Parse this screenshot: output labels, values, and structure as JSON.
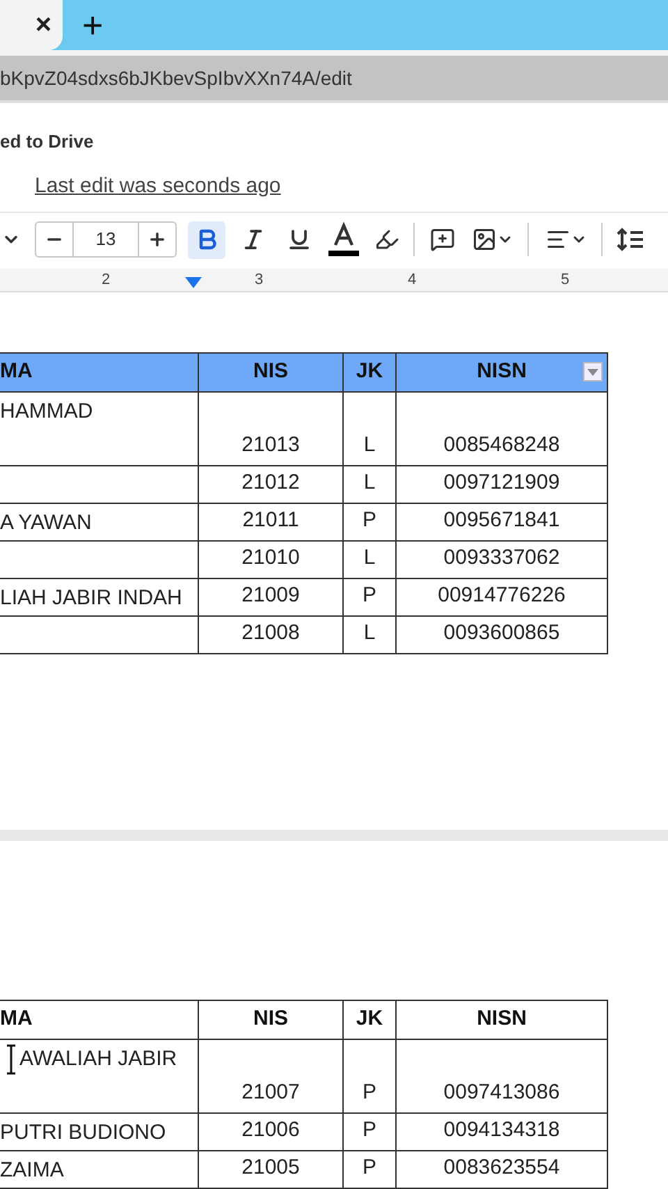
{
  "browser": {
    "close_tab": "×",
    "new_tab": "+",
    "url": "bKpvZ04sdxs6bJKbevSpIbvXXn74A/edit"
  },
  "doc_header": {
    "save_status": "ed to Drive",
    "last_edit": "Last edit was seconds ago"
  },
  "toolbar": {
    "font_size": "13",
    "items": [
      {
        "kind": "bold",
        "selected": true
      },
      {
        "kind": "italic",
        "selected": false
      },
      {
        "kind": "underline",
        "selected": false
      }
    ]
  },
  "ruler": {
    "marks": [
      "2",
      "3",
      "4",
      "5"
    ]
  },
  "tables": [
    {
      "header_highlighted": true,
      "filter": true,
      "columns": [
        "MA",
        "NIS",
        "JK",
        "NISN"
      ],
      "text_cursor": false,
      "rows": [
        {
          "name": "HAMMAD",
          "nis": "21013",
          "jk": "L",
          "nisn": "0085468248",
          "tall": true
        },
        {
          "nis": "21012",
          "jk": "L",
          "nisn": "0097121909",
          "tall": false
        },
        {
          "name": "A YAWAN",
          "nis": "21011",
          "jk": "P",
          "nisn": "0095671841",
          "tall": false
        },
        {
          "nis": "21010",
          "jk": "L",
          "nisn": "0093337062",
          "tall": false
        },
        {
          "name": "LIAH JABIR INDAH",
          "nis": "21009",
          "jk": "P",
          "nisn": "00914776226",
          "tall": false
        },
        {
          "nis": "21008",
          "jk": "L",
          "nisn": "0093600865",
          "tall": false
        }
      ]
    },
    {
      "header_highlighted": false,
      "filter": false,
      "columns": [
        "MA",
        "NIS",
        "JK",
        "NISN"
      ],
      "text_cursor": true,
      "rows": [
        {
          "name": "AWALIAH JABIR",
          "nis": "21007",
          "jk": "P",
          "nisn": "0097413086",
          "tall": true
        },
        {
          "name": "PUTRI BUDIONO",
          "nis": "21006",
          "jk": "P",
          "nisn": "0094134318",
          "tall": false
        },
        {
          "name": "ZAIMA",
          "nis": "21005",
          "jk": "P",
          "nisn": "0083623554",
          "tall": false
        }
      ]
    }
  ]
}
